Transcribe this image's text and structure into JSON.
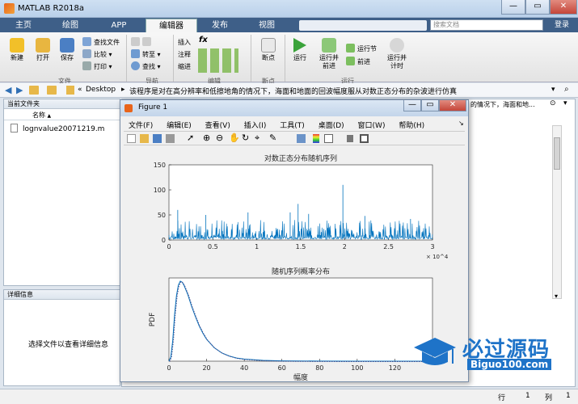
{
  "app": {
    "title": "MATLAB R2018a",
    "search_placeholder": "搜索文档",
    "login": "登录"
  },
  "tabs": [
    "主页",
    "绘图",
    "APP",
    "编辑器",
    "发布",
    "视图"
  ],
  "ribbon": {
    "new": "新建",
    "open": "打开",
    "save": "保存",
    "find_files": "查找文件",
    "compare": "比较",
    "print": "打印",
    "goto": "转至",
    "find": "查找",
    "insert": "插入",
    "comment": "注释",
    "indent": "缩进",
    "breakpoints": "断点",
    "run": "运行",
    "run_advance_1": "运行并",
    "run_advance_2": "前进",
    "run_section": "运行节",
    "advance": "前进",
    "run_time_1": "运行并",
    "run_time_2": "计时",
    "groups": {
      "file": "文件",
      "nav": "导航",
      "edit": "编辑",
      "bp": "断点",
      "run": "运行"
    }
  },
  "path": {
    "root": "«",
    "folder": "Desktop",
    "rest": "该程序是对在高分辨率和低擦地角的情况下，海面和地面的回波幅度服从对数正态分布的杂波进行仿真"
  },
  "editor_strip": "的情况下，海面和地...",
  "current_folder": {
    "title": "当前文件夹",
    "col": "名称",
    "sort": "▲",
    "files": [
      "lognvalue20071219.m"
    ]
  },
  "details": {
    "title": "详细信息",
    "hint": "选择文件以查看详细信息"
  },
  "figure": {
    "title": "Figure 1",
    "menu": [
      "文件(F)",
      "编辑(E)",
      "查看(V)",
      "插入(I)",
      "工具(T)",
      "桌面(D)",
      "窗口(W)",
      "帮助(H)"
    ]
  },
  "status": {
    "row": "行",
    "row_val": "1",
    "col": "列",
    "col_val": "1"
  },
  "watermark": {
    "line1": "必过源码",
    "line2": "Biguo100.com"
  },
  "chart_data": [
    {
      "type": "line",
      "title": "对数正态分布随机序列",
      "xlabel": "",
      "ylabel": "",
      "xlim": [
        0,
        30000
      ],
      "ylim": [
        0,
        150
      ],
      "x_ticks": [
        "0",
        "0.5",
        "1",
        "1.5",
        "2",
        "2.5",
        "3"
      ],
      "x_exponent": "× 10^4",
      "y_ticks": [
        "0",
        "50",
        "100",
        "150"
      ],
      "color": "#0072bd",
      "baseline_range": [
        0,
        40
      ],
      "spikes": [
        {
          "x": 1000,
          "y": 60
        },
        {
          "x": 4200,
          "y": 50
        },
        {
          "x": 9000,
          "y": 55
        },
        {
          "x": 13800,
          "y": 55
        },
        {
          "x": 14700,
          "y": 72
        },
        {
          "x": 15900,
          "y": 52
        },
        {
          "x": 19800,
          "y": 110
        },
        {
          "x": 22300,
          "y": 48
        },
        {
          "x": 27500,
          "y": 42
        }
      ]
    },
    {
      "type": "line",
      "title": "随机序列概率分布",
      "xlabel": "幅度",
      "ylabel": "PDF",
      "xlim": [
        0,
        140
      ],
      "ylim": [
        0,
        0.08
      ],
      "x_ticks": [
        "0",
        "20",
        "40",
        "60",
        "80",
        "100",
        "120"
      ],
      "color": "#0072bd",
      "x": [
        0,
        1,
        2,
        3,
        4,
        5,
        6,
        7,
        8,
        10,
        12,
        14,
        16,
        18,
        20,
        24,
        28,
        32,
        36,
        40,
        50,
        60,
        80,
        100,
        140
      ],
      "y": [
        0,
        0.004,
        0.02,
        0.045,
        0.063,
        0.073,
        0.077,
        0.076,
        0.073,
        0.064,
        0.053,
        0.043,
        0.034,
        0.027,
        0.021,
        0.013,
        0.008,
        0.005,
        0.003,
        0.002,
        0.0008,
        0.0003,
        5e-05,
        0,
        0
      ]
    }
  ]
}
